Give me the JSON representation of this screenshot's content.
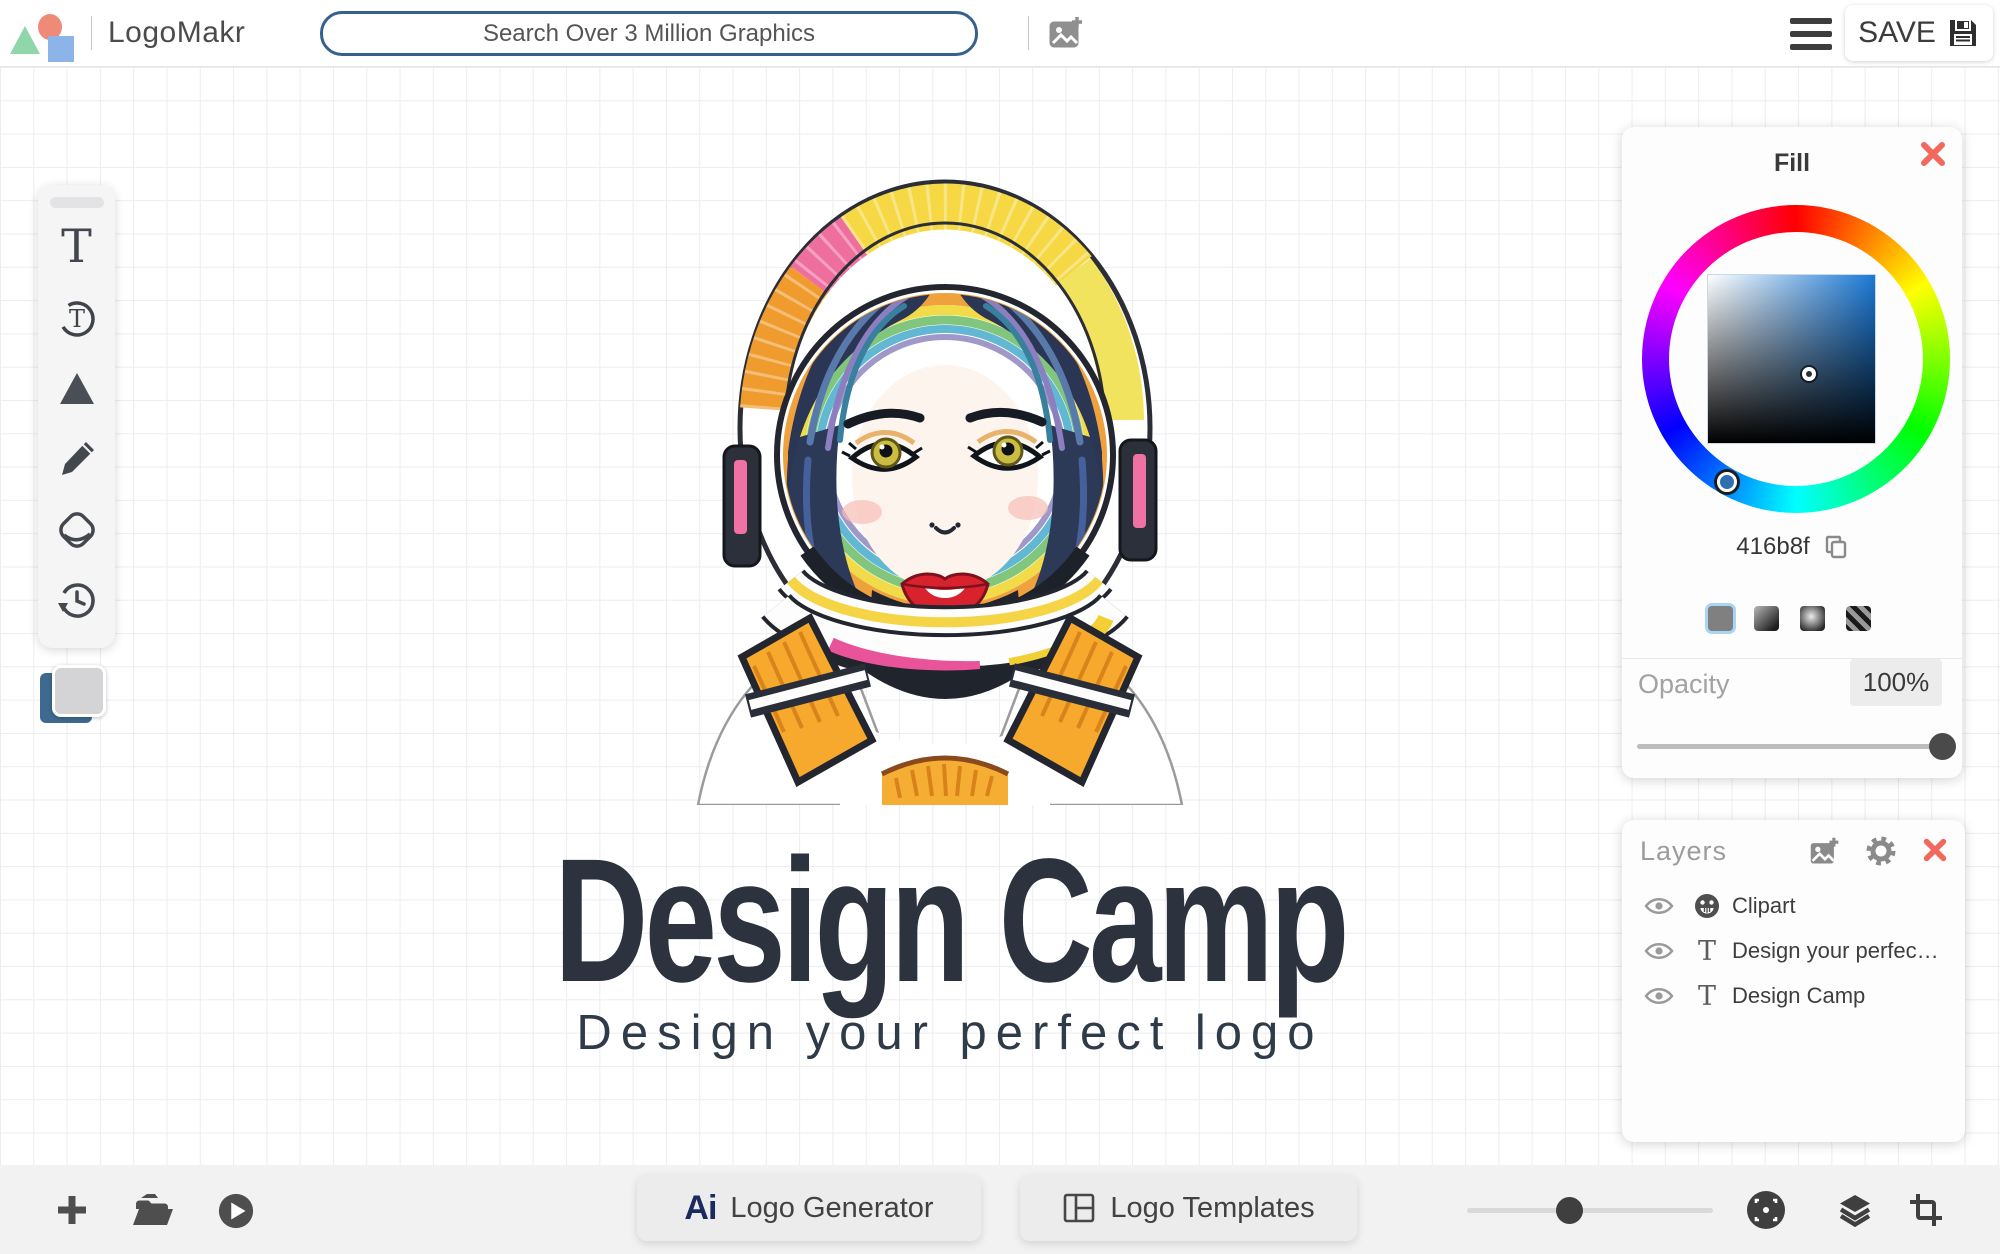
{
  "colors": {
    "accent": "#416b8f",
    "close_red": "#f2685c",
    "search_border": "#35618e",
    "title_text": "#2d333e"
  },
  "header": {
    "brand": "LogoMakr",
    "search": {
      "placeholder": "Search Over 3 Million Graphics"
    },
    "save_label": "SAVE"
  },
  "canvas": {
    "logo_title": "Design Camp",
    "logo_tagline": "Design your perfect logo"
  },
  "fill_panel": {
    "title": "Fill",
    "hex": "416b8f",
    "opacity_label": "Opacity",
    "opacity_value": "100%"
  },
  "layers_panel": {
    "title": "Layers",
    "layers": [
      {
        "kind": "clipart",
        "label": "Clipart"
      },
      {
        "kind": "text",
        "label": "Design your perfec…"
      },
      {
        "kind": "text",
        "label": "Design Camp"
      }
    ]
  },
  "bottom_bar": {
    "ai_badge": "Ai",
    "logo_generator": "Logo Generator",
    "logo_templates": "Logo Templates"
  },
  "icons": [
    "brand-shapes-icon",
    "add-image-icon",
    "menu-icon",
    "floppy-icon",
    "text-tool-icon",
    "circle-text-tool-icon",
    "shapes-tool-icon",
    "draw-tool-icon",
    "eraser-tool-icon",
    "history-tool-icon",
    "close-icon",
    "copy-icon",
    "eye-icon",
    "clipart-smiley-icon",
    "text-layer-icon",
    "gear-icon",
    "plus-icon",
    "open-folder-icon",
    "play-icon",
    "ai-icon",
    "template-icon",
    "fit-screen-icon",
    "layers-stack-icon",
    "crop-icon"
  ]
}
